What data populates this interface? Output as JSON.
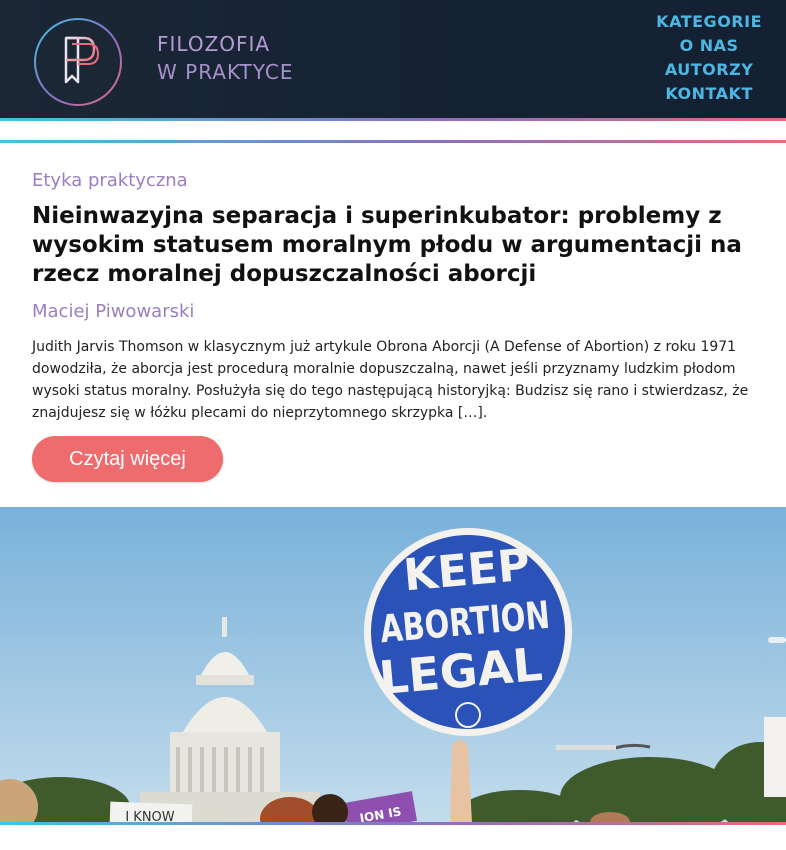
{
  "header": {
    "brand_line1": "FILOZOFIA",
    "brand_line2": "W PRAKTYCE",
    "nav": [
      "KATEGORIE",
      "O NAS",
      "AUTORZY",
      "KONTAKT"
    ]
  },
  "article": {
    "category": "Etyka praktyczna",
    "title": "Nieinwazyjna separacja i superinkubator: problemy z wysokim statusem moralnym płodu w argumentacji na rzecz moralnej dopuszczalności aborcji",
    "author": "Maciej Piwowarski",
    "excerpt": "Judith Jarvis Thomson w klasycznym już artykule Obrona Aborcji (A Defense of Abortion) z roku 1971 dowodziła, że aborcja jest procedurą moralnie dopuszczalną, nawet jeśli przyznamy ludzkim płodom wysoki status moralny. Posłużyła się do tego następującą historyjką: Budzisz się rano i stwierdzasz, że znajdujesz się w łóżku plecami do nieprzytomnego skrzypka […].",
    "read_more": "Czytaj więcej"
  },
  "photo": {
    "sign_line1": "KEEP",
    "sign_line2": "ABORTION",
    "sign_line3": "LEGAL",
    "small_sign": "I KNOW",
    "purple_sign": "ION IS"
  },
  "colors": {
    "accent_purple": "#9b7ec1",
    "nav_blue": "#4fb6e3",
    "button_coral": "#ee6b6e",
    "header_bg": "#1b2735",
    "sign_blue": "#2a4fb0"
  }
}
